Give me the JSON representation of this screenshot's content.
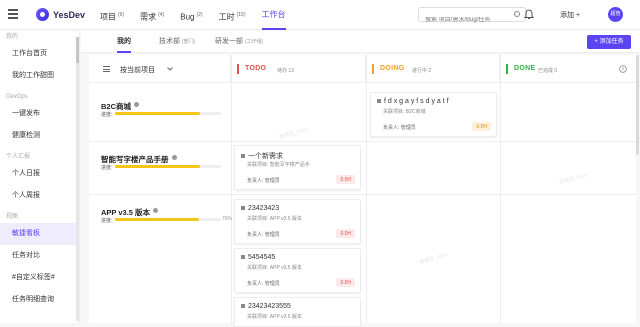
{
  "app": {
    "logo_text": "YesDev"
  },
  "nav": [
    {
      "label": "项目",
      "count": "(6)"
    },
    {
      "label": "需求",
      "count": "(4)"
    },
    {
      "label": "Bug",
      "count": "(2)"
    },
    {
      "label": "工时",
      "count": "(15)"
    },
    {
      "label": "工作台",
      "count": ""
    }
  ],
  "search": {
    "placeholder": "搜索 项目/需求/Bug/任务"
  },
  "header": {
    "add_label": "添加 +",
    "avatar_text": "超管"
  },
  "sidebar": {
    "groups": [
      {
        "title": "我的",
        "items": [
          "工作台首页",
          "我的工作甜图"
        ]
      },
      {
        "title": "DevOps",
        "items": [
          "一键发布",
          "健康检测"
        ]
      },
      {
        "title": "个人汇报",
        "items": [
          "个人日报",
          "个人周报"
        ]
      },
      {
        "title": "视图",
        "items": [
          "敏捷看板",
          "任务对比",
          "#自定义标签#",
          "任务明细查询"
        ]
      }
    ],
    "active_item": "敏捷看板"
  },
  "tabs": [
    {
      "label": "我的",
      "sub": ""
    },
    {
      "label": "技术部",
      "sub": "(部门)"
    },
    {
      "label": "研发一部",
      "sub": "(工作组)"
    }
  ],
  "add_task_label": "+ 添加任务",
  "board": {
    "group_by_label": "按当前项目",
    "columns": [
      {
        "title": "TODO",
        "status": "待办 13",
        "color": "#e25050"
      },
      {
        "title": "DOING",
        "status": "进行中 2",
        "color": "#f0a020"
      },
      {
        "title": "DONE",
        "status": "已完成 0",
        "color": "#2fb344"
      }
    ],
    "projects": [
      {
        "name": "B2C商城",
        "progress_label": "进度:",
        "progress": 0.8,
        "pct": ""
      },
      {
        "name": "智能写字楼产品手册",
        "progress_label": "进度:",
        "progress": 0.8,
        "pct": ""
      },
      {
        "name": "APP v3.5 版本",
        "progress_label": "进度:",
        "progress": 0.79,
        "pct": "79%"
      }
    ],
    "cards": {
      "doing_b2c": {
        "title": "f d x g a y f s d y a t f",
        "project": "关联项目: B2C商城",
        "owner": "负责人: 管理员",
        "hours": "0.0H"
      },
      "todo_smart": {
        "title": "一个新需求",
        "project": "关联项目: 智能写字楼产品手",
        "owner": "负责人: 管理员",
        "hours": "0.0H"
      },
      "todo_app1": {
        "title": "23423423",
        "project": "关联项目: APP v3.5 版本",
        "owner": "负责人: 管理员",
        "hours": "0.0H"
      },
      "todo_app2": {
        "title": "5454545",
        "project": "关联项目: APP v3.5 版本",
        "owner": "负责人: 管理员",
        "hours": "0.0H"
      },
      "todo_app3": {
        "title": "23423423555",
        "project": "关联项目: APP v3.5 版本",
        "owner": "",
        "hours": ""
      }
    }
  },
  "watermark": "管理员_0000"
}
